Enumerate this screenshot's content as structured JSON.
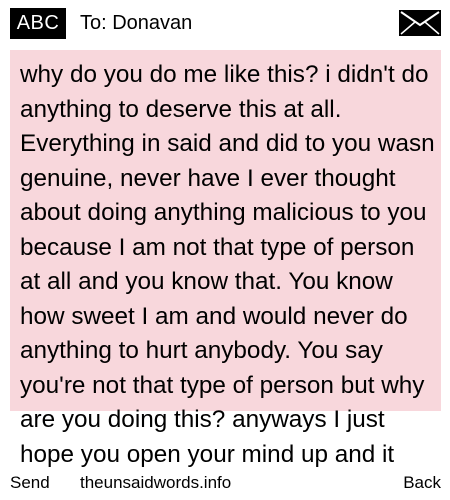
{
  "header": {
    "input_mode": "ABC",
    "recipient": "To: Donavan",
    "icon": "envelope-icon"
  },
  "message": {
    "body": "why do you do me like this? i didn't do anything to deserve this at all. Everything in said and did to you wasn genuine, never have I ever thought about doing anything malicious to you because I am not that type of person at all and you know that. You know how sweet I am and would never do anything to hurt anybody. You say you're not that type of person but why are you doing this? anyways I just hope you open your mind up and it",
    "highlight_color": "#f8d7dc"
  },
  "softkeys": {
    "left": "Send",
    "center": "theunsaidwords.info",
    "right": "Back"
  }
}
